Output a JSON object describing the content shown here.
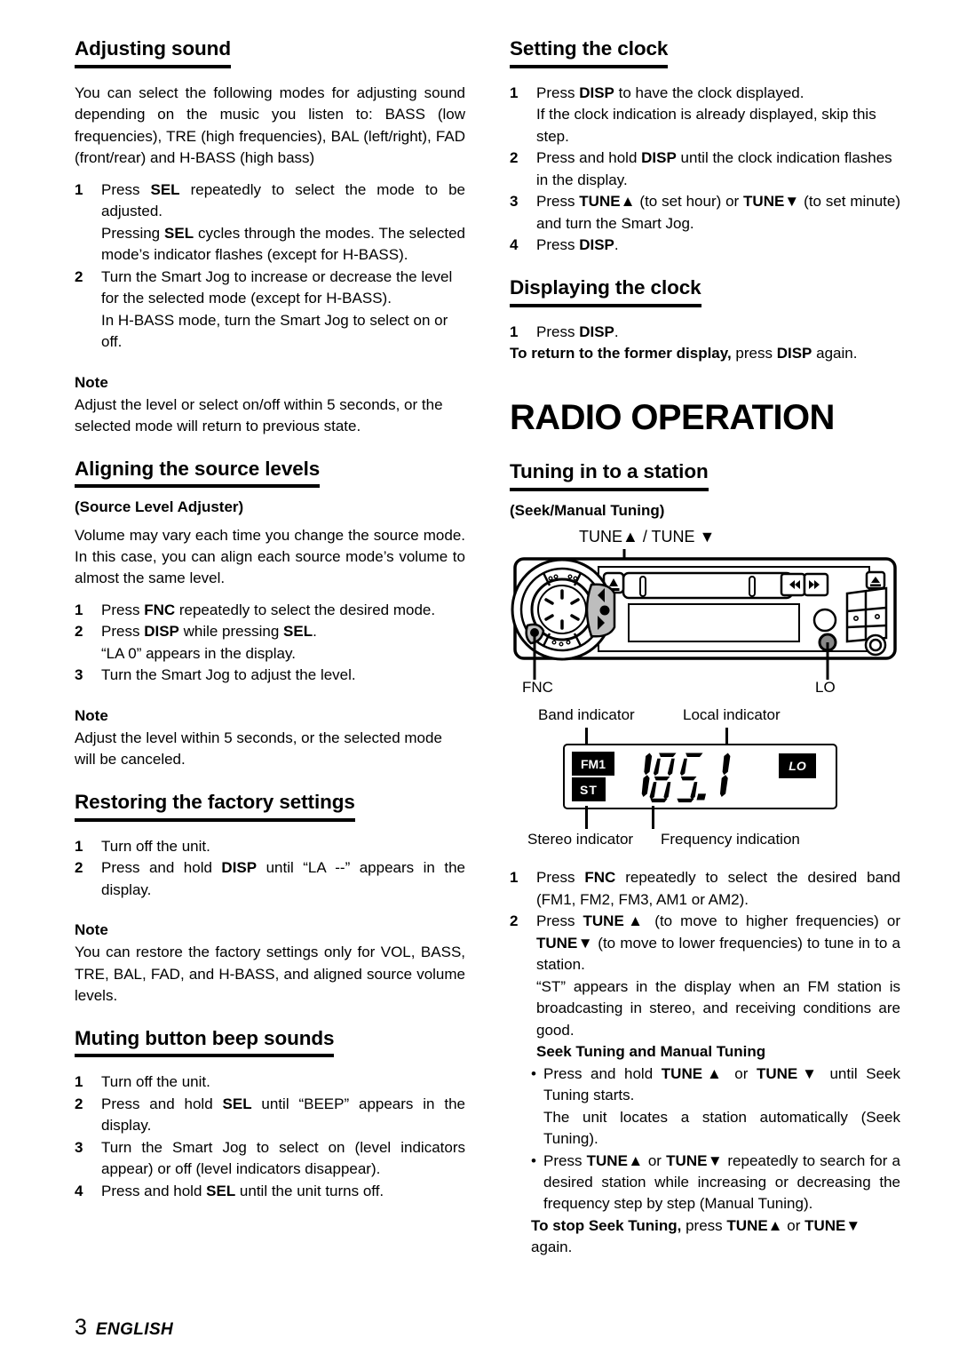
{
  "document": {
    "footer_page": "3",
    "footer_language": "ENGLISH"
  },
  "left_column": {
    "s1": {
      "heading": "Adjusting sound",
      "intro": "You can select the following modes for adjusting sound depending on the music you listen to: BASS (low frequencies), TRE (high frequencies), BAL (left/right), FAD (front/rear) and H-BASS (high bass)",
      "step1_num": "1",
      "step1_a": "Press ",
      "step1_sel": "SEL",
      "step1_b": " repeatedly to select the mode to be adjusted.",
      "step1_sub_a": "Pressing ",
      "step1_sub_sel": "SEL",
      "step1_sub_b": " cycles through the modes. The selected mode’s indicator flashes (except for H-BASS).",
      "step2_num": "2",
      "step2": "Turn the Smart Jog to increase or decrease the level for the selected mode (except for H-BASS).",
      "step2_sub": "In H-BASS mode, turn the Smart Jog to select on or off.",
      "note_heading": "Note",
      "note_body": "Adjust the level or select on/off within 5 seconds, or the selected mode will return to previous state."
    },
    "s2": {
      "heading": "Aligning the source levels",
      "subheading": "(Source Level Adjuster)",
      "intro": "Volume may vary each time you change the source mode. In this case, you can align each source mode’s volume to almost the same level.",
      "step1_num": "1",
      "step1_a": "Press ",
      "step1_fnc": "FNC",
      "step1_b": " repeatedly to select the desired mode.",
      "step2_num": "2",
      "step2_a": "Press ",
      "step2_disp": "DISP",
      "step2_b": " while pressing ",
      "step2_sel": "SEL",
      "step2_c": ".",
      "step2_sub": "“LA 0” appears in the display.",
      "step3_num": "3",
      "step3": "Turn the Smart Jog to adjust the level.",
      "note_heading": "Note",
      "note_body": "Adjust the level within 5 seconds, or the selected mode will be canceled."
    },
    "s3": {
      "heading": "Restoring the factory settings",
      "step1_num": "1",
      "step1": "Turn off the unit.",
      "step2_num": "2",
      "step2_a": "Press and hold ",
      "step2_disp": "DISP",
      "step2_b": " until “LA --” appears in the display.",
      "note_heading": "Note",
      "note_body": "You can restore the factory settings only for VOL, BASS, TRE, BAL, FAD, and H-BASS, and aligned source volume levels."
    },
    "s4": {
      "heading": "Muting button beep sounds",
      "step1_num": "1",
      "step1": "Turn off the unit.",
      "step2_num": "2",
      "step2_a": "Press and hold ",
      "step2_sel": "SEL",
      "step2_b": " until “BEEP” appears in the display.",
      "step3_num": "3",
      "step3": "Turn the Smart Jog to select on (level indicators appear) or off (level indicators disappear).",
      "step4_num": "4",
      "step4_a": "Press and hold ",
      "step4_sel": "SEL",
      "step4_b": " until the unit turns off."
    }
  },
  "right_column": {
    "s1": {
      "heading": "Setting the clock",
      "step1_num": "1",
      "step1_a": "Press ",
      "step1_disp": "DISP",
      "step1_b": " to have the clock displayed.",
      "step1_sub": "If the clock indication is already displayed, skip this step.",
      "step2_num": "2",
      "step2_a": "Press and hold ",
      "step2_disp": "DISP",
      "step2_b": " until the clock indication flashes in the display.",
      "step3_num": "3",
      "step3_a": "Press ",
      "step3_tune_up": "TUNE▲",
      "step3_b": " (to set hour) or ",
      "step3_tune_dn": "TUNE▼",
      "step3_c": " (to set minute) and turn the Smart Jog.",
      "step4_num": "4",
      "step4_a": "Press ",
      "step4_disp": "DISP",
      "step4_b": "."
    },
    "s2": {
      "heading": "Displaying the clock",
      "step1_num": "1",
      "step1_a": "Press ",
      "step1_disp": "DISP",
      "step1_b": ".",
      "return_bold": "To return to the former display,",
      "return_a": " press ",
      "return_disp": "DISP",
      "return_b": " again."
    },
    "chapter_title": "RADIO OPERATION",
    "s3": {
      "heading": "Tuning in to a station",
      "subheading": "(Seek/Manual Tuning)"
    },
    "unit_figure": {
      "label_tune": "TUNE▲ / TUNE ▼",
      "label_fnc": "FNC",
      "label_lo": "LO",
      "icon_eject": "▲",
      "icon_rew": "◄◄",
      "icon_ff": "►►",
      "icon_up": "▲",
      "icon_down": "▼",
      "icon_release": "▲"
    },
    "lcd_figure": {
      "label_band": "Band indicator",
      "label_local": "Local indicator",
      "label_stereo": "Stereo indicator",
      "label_frequency": "Frequency indication",
      "badge_band": "FM1",
      "badge_stereo": "ST",
      "badge_local": "LO",
      "frequency_value": "105.1"
    },
    "s4": {
      "step1_num": "1",
      "step1_a": "Press ",
      "step1_fnc": "FNC",
      "step1_b": " repeatedly to select the desired band (FM1, FM2, FM3, AM1 or AM2).",
      "step2_num": "2",
      "step2_a": "Press ",
      "step2_tune_up": "TUNE▲",
      "step2_b": " (to move to higher frequencies) or ",
      "step2_tune_dn": "TUNE▼",
      "step2_c": " (to move to lower frequencies) to tune in to a station.",
      "step2_sub": "“ST” appears in the display when an FM station is broadcasting in stereo, and receiving conditions are good.",
      "seek_heading": "Seek Tuning and Manual Tuning",
      "b1_dot": "•",
      "b1_a": "Press and hold ",
      "b1_tune_up": "TUNE▲",
      "b1_b": " or ",
      "b1_tune_dn": "TUNE▼",
      "b1_c": " until Seek Tuning starts.",
      "b1_sub": "The unit locates a station automatically (Seek Tuning).",
      "b2_dot": "•",
      "b2_a": "Press ",
      "b2_tune_up": "TUNE▲",
      "b2_b": " or ",
      "b2_tune_dn": "TUNE▼",
      "b2_c": " repeatedly to search for a desired station while increasing or decreasing the frequency step by step (Manual Tuning).",
      "stop_bold": "To stop Seek Tuning,",
      "stop_a": " press ",
      "stop_tune_up": "TUNE▲",
      "stop_b": " or ",
      "stop_tune_dn": "TUNE▼",
      "stop_c": " again."
    }
  }
}
